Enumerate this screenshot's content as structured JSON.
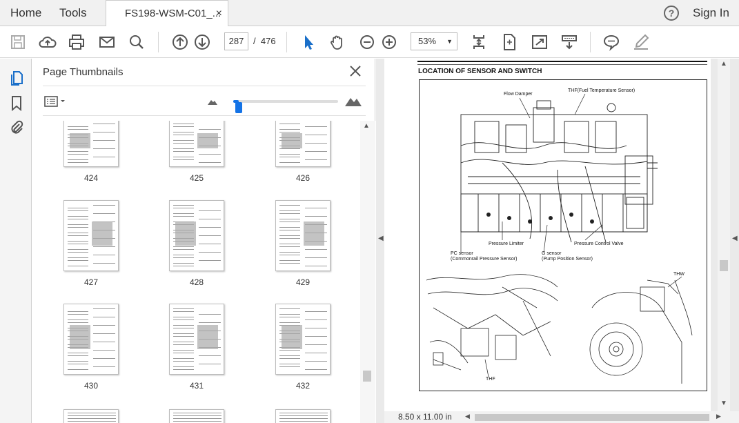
{
  "menubar": {
    "home": "Home",
    "tools": "Tools",
    "tab_title": "FS198-WSM-C01_...",
    "tab_close": "×",
    "help": "?",
    "sign_in": "Sign In"
  },
  "toolbar": {
    "page_current": "287",
    "page_separator": "/",
    "page_total": "476",
    "zoom": "53%",
    "zoom_arrow": "▼"
  },
  "panel": {
    "title": "Page Thumbnails",
    "thumbnail_size": 0.05,
    "thumbnails": [
      {
        "label": "424"
      },
      {
        "label": "425"
      },
      {
        "label": "426"
      },
      {
        "label": "427"
      },
      {
        "label": "428"
      },
      {
        "label": "429"
      },
      {
        "label": "430"
      },
      {
        "label": "431"
      },
      {
        "label": "432"
      }
    ]
  },
  "document": {
    "heading": "LOCATION OF SENSOR AND SWITCH",
    "labels": {
      "flow_damper": "Flow Damper",
      "thf_fuel_temp": "THF(Fuel Temperature Sensor)",
      "pressure_limiter": "Pressure Limiter",
      "pressure_control_valve": "Pressure Control Valve",
      "pc_sensor": "PC sensor",
      "pc_sensor_sub": "(Commonrail Pressure Sensor)",
      "g_sensor": "G sensor",
      "g_sensor_sub": "(Pump Position Sensor)",
      "thf": "THF",
      "thw": "THW"
    },
    "page_size": "8.50 x 11.00 in"
  }
}
